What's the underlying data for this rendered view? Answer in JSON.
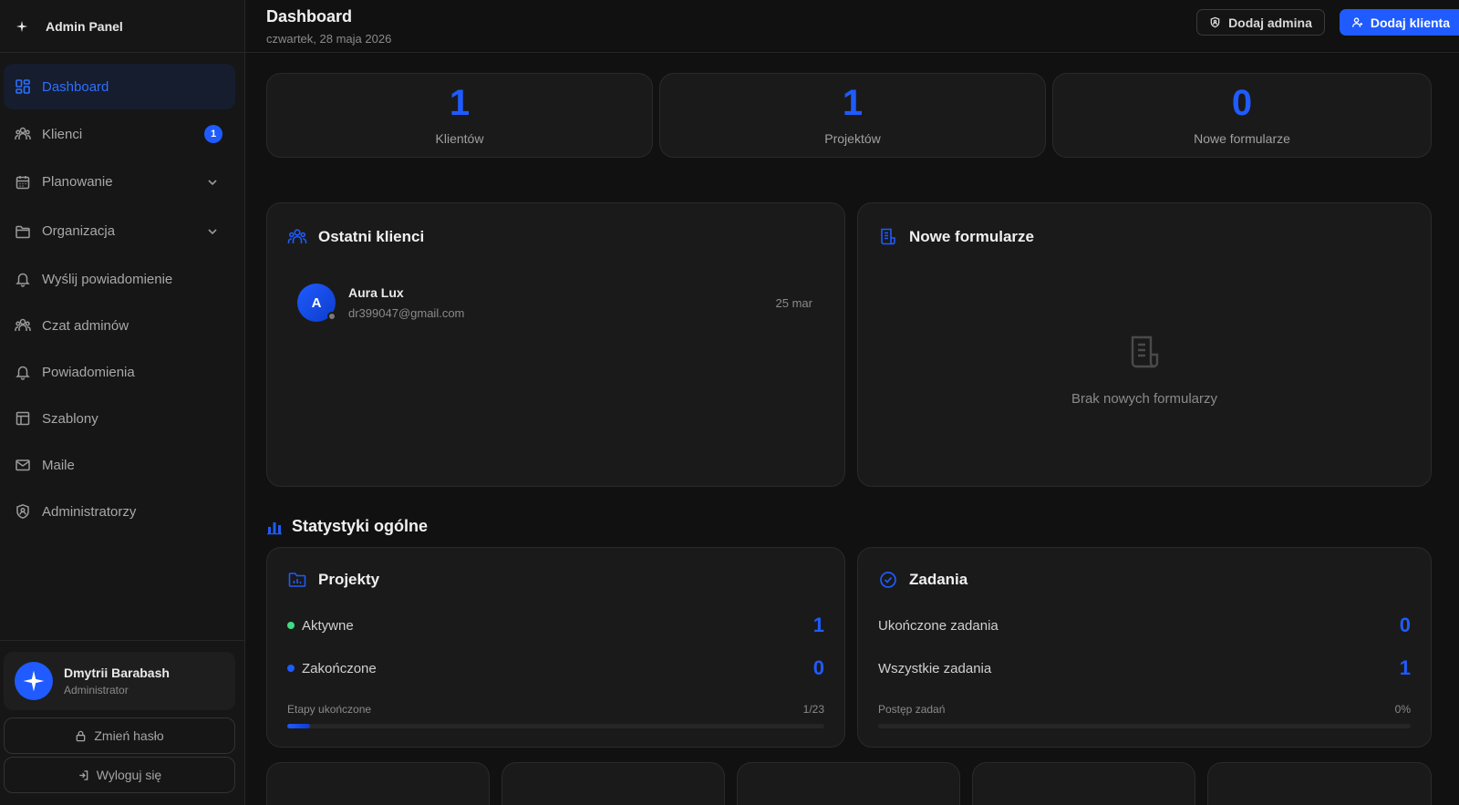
{
  "brand": {
    "title": "Admin Panel"
  },
  "sidebar": {
    "items": [
      {
        "label": "Dashboard",
        "icon": "dashboard-icon",
        "active": true
      },
      {
        "label": "Klienci",
        "icon": "users-icon",
        "badge": "1"
      },
      {
        "label": "Planowanie",
        "icon": "calendar-icon",
        "expandable": true
      },
      {
        "label": "Organizacja",
        "icon": "folder-icon",
        "expandable": true
      },
      {
        "label": "Wyślij powiadomienie",
        "icon": "bell-icon"
      },
      {
        "label": "Czat adminów",
        "icon": "users-icon"
      },
      {
        "label": "Powiadomienia",
        "icon": "bell-icon"
      },
      {
        "label": "Szablony",
        "icon": "layout-icon"
      },
      {
        "label": "Maile",
        "icon": "mail-icon"
      },
      {
        "label": "Administratorzy",
        "icon": "shield-user-icon"
      }
    ],
    "user": {
      "name": "Dmytrii Barabash",
      "role": "Administrator"
    },
    "change_password": "Zmień hasło",
    "logout": "Wyloguj się"
  },
  "header": {
    "title": "Dashboard",
    "date": "czwartek, 28 maja 2026",
    "add_admin": "Dodaj admina",
    "add_client": "Dodaj klienta"
  },
  "stats": [
    {
      "value": "1",
      "label": "Klientów"
    },
    {
      "value": "1",
      "label": "Projektów"
    },
    {
      "value": "0",
      "label": "Nowe formularze"
    }
  ],
  "recent_clients": {
    "title": "Ostatni klienci",
    "items": [
      {
        "initial": "A",
        "name": "Aura Lux",
        "email": "dr399047@gmail.com",
        "date": "25 mar"
      }
    ]
  },
  "new_forms": {
    "title": "Nowe formularze",
    "empty_text": "Brak nowych formularzy"
  },
  "general_stats": {
    "title": "Statystyki ogólne"
  },
  "projects": {
    "title": "Projekty",
    "active_label": "Aktywne",
    "active_value": "1",
    "done_label": "Zakończone",
    "done_value": "0",
    "progress_label": "Etapy ukończone",
    "progress_value": "1/23",
    "progress_fraction": 0.043
  },
  "tasks": {
    "title": "Zadania",
    "completed_label": "Ukończone zadania",
    "completed_value": "0",
    "all_label": "Wszystkie zadania",
    "all_value": "1",
    "progress_label": "Postęp zadań",
    "progress_value": "0%",
    "progress_fraction": 0
  },
  "colors": {
    "accent": "#1f5bff",
    "active_green": "#3ddc84",
    "background": "#111111",
    "card": "#1a1a1a"
  }
}
